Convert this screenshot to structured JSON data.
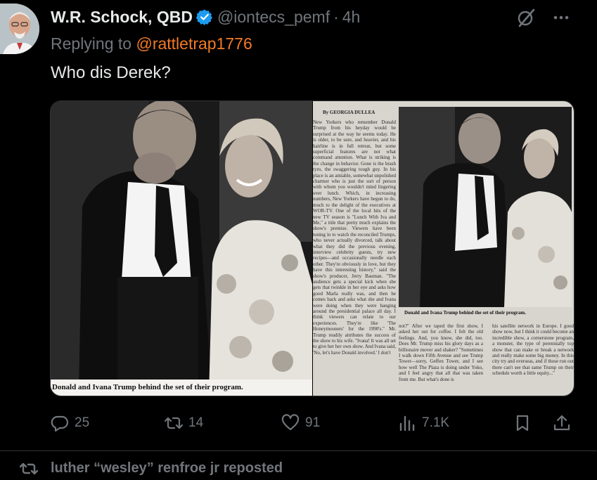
{
  "tweet": {
    "display_name": "W.R. Schock, QBD",
    "handle": "@iontecs_pemf",
    "separator": "·",
    "time": "4h",
    "replying_prefix": "Replying to",
    "replying_to": "@rattletrap1776",
    "text": "Who dis Derek?"
  },
  "media": {
    "left_caption": "Donald and Ivana Trump behind the set of their program.",
    "right_byline": "By GEORGIA DULLEA",
    "right_caption": "Donald and Ivana Trump behind the set of their program.",
    "right_col1": "New Yorkers who remember Donald Trump from his heyday would be surprised at the way he seems today. He is older, to be sure, and heavier, and his hairline is in full retreat, but some superficial features are not what command attention. What is striking is the change in behavior. Gone is the brash tyro, the swaggering tough guy. In his place is an amiable, somewhat unpolished charmer who is just the sort of person with whom you wouldn't mind lingering over lunch. Which, in increasing numbers, New Yorkers have begun to do, much to the delight of the executives at WOR-TV. One of the local hits of the new TV season is \"Lunch With Iva and Me,\" a title that pretty much explains the show's premise. Viewers have been tuning in to watch the reconciled Trumps, who never actually divorced, talk about what they did the previous evening, interview celebrity guests, try new recipes—and occasionally needle each other. They're obviously in love, but they have this interesting history,\" said the show's producer, Jerry Bauman. \"The audience gets a special kick when she gets that twinkle in her eye and asks how good Marla really was, and then he comes back and asks what she and Ivana were doing when they were hanging around the presidential palace all day. I think viewers can relate to our experiences. They're like 'The Honeymooners' for the 1990's.\" Mr. Trump readily attributes the success of the show to his wife. \"Ivana! It was all set to give her her own show. And Ivana said, 'No, let's have Donald involved.' I don't",
    "right_col2": "not?\" After we taped the first show, I asked her out for coffee. I felt the old feelings. And, you know, she did, too. Does Mr. Trump miss his glory days as a billionaire mover and shaker? \"Sometimes I walk down Fifth Avenue and see Trump Tower—sorry, Geffen Tower, and I see how well The Plaza is doing under Yoko, and I feel angry that all that was taken from me. But what's done is",
    "right_col3": "his satellite network in Europe. I good show now, but I think it could become an incredible show, a cornerstone program, a monster, the type of perennially top show that can make or break a network and really make some big money. In this city try and overseas, and if those run out there can't see that same Trump on their schedule worth a little equity...\""
  },
  "stats": {
    "replies": "25",
    "reposts": "14",
    "likes": "91",
    "views": "7.1K"
  },
  "next_item": {
    "repost_label": "luther “wesley” renfroe jr reposted"
  },
  "icons": {
    "verified": "verified-badge-icon",
    "grok": "grok-icon",
    "more": "more-icon",
    "reply": "reply-icon",
    "repost": "repost-icon",
    "like": "like-icon",
    "views": "views-icon",
    "bookmark": "bookmark-icon",
    "share": "share-icon"
  },
  "colors": {
    "background": "#000000",
    "text": "#e7e9ea",
    "muted": "#71767b",
    "link": "#f17a24",
    "verified": "#1d9bf0",
    "divider": "#2f3336"
  }
}
